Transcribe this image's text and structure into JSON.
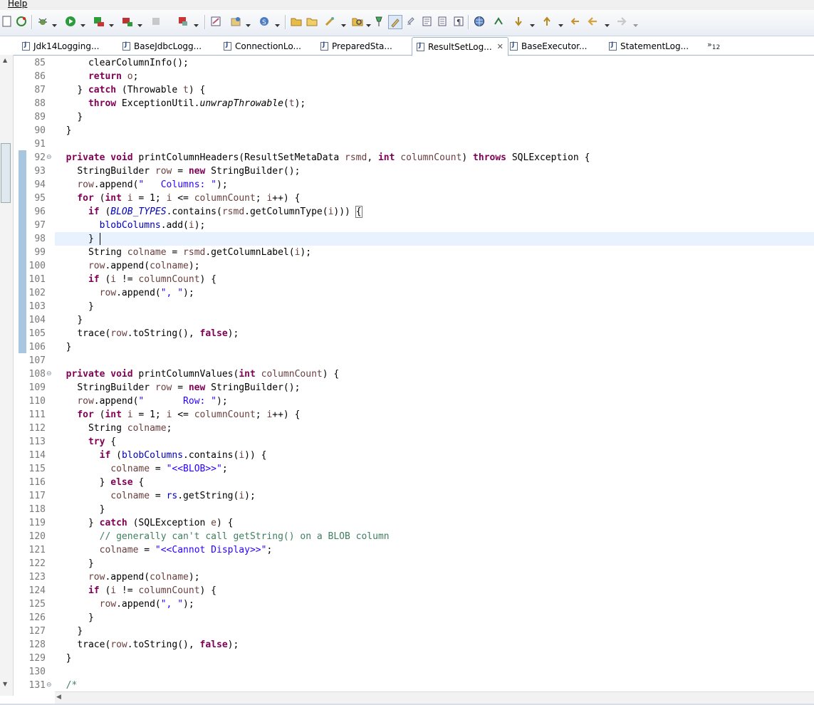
{
  "menu": {
    "help_label": "Help"
  },
  "toolbar": {
    "icons": [
      "new-icon",
      "refresh-icon",
      "debug-icon",
      "run-icon",
      "run-external-icon",
      "coverage-icon",
      "stop-icon",
      "terminate-icon",
      "build-icon",
      "new-class-icon",
      "open-type-icon",
      "folder-icon",
      "task-icon",
      "search-icon",
      "pin-icon",
      "highlight-icon",
      "edit-icon",
      "doc-icon",
      "paragraph-icon",
      "globe-icon",
      "link-icon",
      "next-annotation-icon",
      "prev-annotation-icon",
      "back-icon",
      "forward-icon"
    ]
  },
  "tabs": [
    {
      "label": "Jdk14Logging...",
      "active": false
    },
    {
      "label": "BaseJdbcLogg...",
      "active": false
    },
    {
      "label": "ConnectionLo...",
      "active": false
    },
    {
      "label": "PreparedSta...",
      "active": false
    },
    {
      "label": "ResultSetLog...",
      "active": true
    },
    {
      "label": "BaseExecutor...",
      "active": false
    },
    {
      "label": "StatementLog...",
      "active": false
    }
  ],
  "tabs_overflow": {
    "symbol": "»",
    "count": "12"
  },
  "editor": {
    "line_numbers": [
      "85",
      "86",
      "87",
      "88",
      "89",
      "90",
      "91",
      "92",
      "93",
      "94",
      "95",
      "96",
      "97",
      "98",
      "99",
      "100",
      "101",
      "102",
      "103",
      "104",
      "105",
      "106",
      "107",
      "108",
      "109",
      "110",
      "111",
      "112",
      "113",
      "114",
      "115",
      "116",
      "117",
      "118",
      "119",
      "120",
      "121",
      "122",
      "123",
      "124",
      "125",
      "126",
      "127",
      "128",
      "129",
      "130",
      "131"
    ],
    "code": {
      "l85_a": "clearColumnInfo();",
      "l86_kw": "return",
      "l86_var": "o",
      "l86_end": ";",
      "l87_a": "} ",
      "l87_kw": "catch",
      "l87_b": " (Throwable ",
      "l87_var": "t",
      "l87_c": ") {",
      "l88_kw": "throw",
      "l88_a": " ExceptionUtil.",
      "l88_m": "unwrapThrowable",
      "l88_b": "(",
      "l88_var": "t",
      "l88_c": ");",
      "l89": "}",
      "l90": "}",
      "l92_kw1": "private",
      "l92_kw2": "void",
      "l92_a": " printColumnHeaders(ResultSetMetaData ",
      "l92_var1": "rsmd",
      "l92_b": ", ",
      "l92_kw3": "int",
      "l92_var2": "columnCount",
      "l92_c": ") ",
      "l92_kw4": "throws",
      "l92_d": " SQLException {",
      "l93_a": "StringBuilder ",
      "l93_var": "row",
      "l93_b": " = ",
      "l93_kw": "new",
      "l93_c": " StringBuilder();",
      "l94_var": "row",
      "l94_a": ".append(",
      "l94_str": "\"   Columns: \"",
      "l94_b": ");",
      "l95_kw1": "for",
      "l95_a": " (",
      "l95_kw2": "int",
      "l95_var1": "i",
      "l95_b": " = 1; ",
      "l95_var2": "i",
      "l95_c": " <= ",
      "l95_var3": "columnCount",
      "l95_d": "; ",
      "l95_var4": "i",
      "l95_e": "++) {",
      "l96_kw": "if",
      "l96_a": " (",
      "l96_sfld": "BLOB_TYPES",
      "l96_b": ".contains(",
      "l96_var1": "rsmd",
      "l96_c": ".getColumnType(",
      "l96_var2": "i",
      "l96_d": "))) ",
      "l96_brace": "{",
      "l97_fld": "blobColumns",
      "l97_a": ".add(",
      "l97_var": "i",
      "l97_b": ");",
      "l98": "}",
      "l99_a": "String ",
      "l99_var1": "colname",
      "l99_b": " = ",
      "l99_var2": "rsmd",
      "l99_c": ".getColumnLabel(",
      "l99_var3": "i",
      "l99_d": ");",
      "l100_var1": "row",
      "l100_a": ".append(",
      "l100_var2": "colname",
      "l100_b": ");",
      "l101_kw": "if",
      "l101_a": " (",
      "l101_var1": "i",
      "l101_b": " != ",
      "l101_var2": "columnCount",
      "l101_c": ") {",
      "l102_var": "row",
      "l102_a": ".append(",
      "l102_str": "\", \"",
      "l102_b": ");",
      "l103": "}",
      "l104": "}",
      "l105_a": "trace(",
      "l105_var": "row",
      "l105_b": ".toString(), ",
      "l105_kw": "false",
      "l105_c": ");",
      "l106": "}",
      "l108_kw1": "private",
      "l108_kw2": "void",
      "l108_a": " printColumnValues(",
      "l108_kw3": "int",
      "l108_var": "columnCount",
      "l108_b": ") {",
      "l109_a": "StringBuilder ",
      "l109_var": "row",
      "l109_b": " = ",
      "l109_kw": "new",
      "l109_c": " StringBuilder();",
      "l110_var": "row",
      "l110_a": ".append(",
      "l110_str": "\"       Row: \"",
      "l110_b": ");",
      "l111_kw1": "for",
      "l111_a": " (",
      "l111_kw2": "int",
      "l111_var1": "i",
      "l111_b": " = 1; ",
      "l111_var2": "i",
      "l111_c": " <= ",
      "l111_var3": "columnCount",
      "l111_d": "; ",
      "l111_var4": "i",
      "l111_e": "++) {",
      "l112_a": "String ",
      "l112_var": "colname",
      "l112_b": ";",
      "l113_kw": "try",
      "l113_a": " {",
      "l114_kw": "if",
      "l114_a": " (",
      "l114_fld": "blobColumns",
      "l114_b": ".contains(",
      "l114_var": "i",
      "l114_c": ")) {",
      "l115_var": "colname",
      "l115_a": " = ",
      "l115_str": "\"<<BLOB>>\"",
      "l115_b": ";",
      "l116_a": "} ",
      "l116_kw": "else",
      "l116_b": " {",
      "l117_var1": "colname",
      "l117_a": " = ",
      "l117_fld": "rs",
      "l117_b": ".getString(",
      "l117_var2": "i",
      "l117_c": ");",
      "l118": "}",
      "l119_a": "} ",
      "l119_kw": "catch",
      "l119_b": " (SQLException ",
      "l119_var": "e",
      "l119_c": ") {",
      "l120_cmt": "// generally can't call getString() on a BLOB column",
      "l121_var": "colname",
      "l121_a": " = ",
      "l121_str": "\"<<Cannot Display>>\"",
      "l121_b": ";",
      "l122": "}",
      "l123_var1": "row",
      "l123_a": ".append(",
      "l123_var2": "colname",
      "l123_b": ");",
      "l124_kw": "if",
      "l124_a": " (",
      "l124_var1": "i",
      "l124_b": " != ",
      "l124_var2": "columnCount",
      "l124_c": ") {",
      "l125_var": "row",
      "l125_a": ".append(",
      "l125_str": "\", \"",
      "l125_b": ");",
      "l126": "}",
      "l127": "}",
      "l128_a": "trace(",
      "l128_var": "row",
      "l128_b": ".toString(), ",
      "l128_kw": "false",
      "l128_c": ");",
      "l129": "}",
      "l131_cmt": "/*"
    },
    "current_line": "98",
    "fold_markers": [
      "92",
      "108",
      "131"
    ]
  },
  "colors": {
    "keyword": "#7f0055",
    "string": "#2a00ff",
    "field": "#0000c0",
    "local_var": "#6a3e3e",
    "comment": "#3f7f5f",
    "line_number": "#787878",
    "current_line_bg": "#e8f2fe"
  }
}
